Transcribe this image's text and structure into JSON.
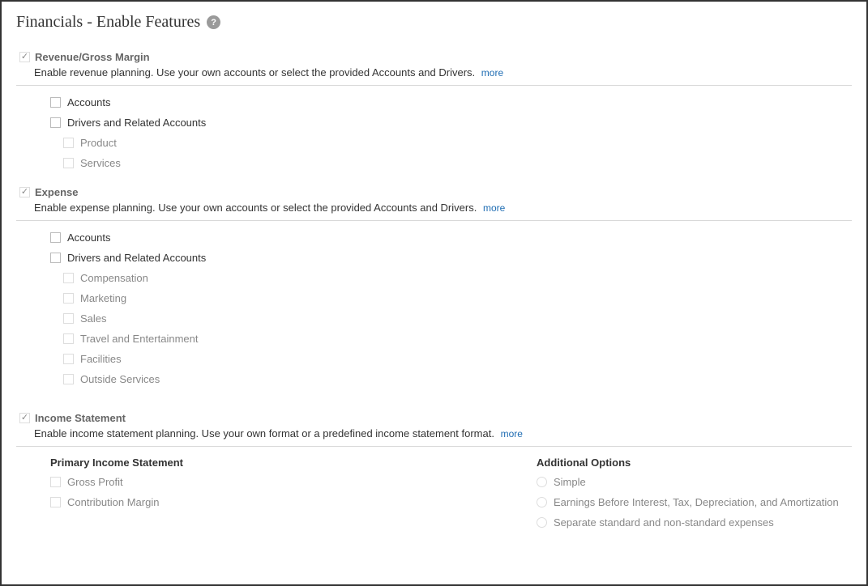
{
  "page": {
    "title": "Financials - Enable Features",
    "more_label": "more"
  },
  "sections": {
    "revenue": {
      "title": "Revenue/Gross Margin",
      "desc": "Enable revenue planning. Use your own accounts or select the provided Accounts and Drivers.",
      "accounts": "Accounts",
      "drivers": "Drivers and Related Accounts",
      "product": "Product",
      "services": "Services"
    },
    "expense": {
      "title": "Expense",
      "desc": "Enable expense planning. Use your own accounts or select the provided Accounts and Drivers.",
      "accounts": "Accounts",
      "drivers": "Drivers and Related Accounts",
      "compensation": "Compensation",
      "marketing": "Marketing",
      "sales": "Sales",
      "travel": "Travel and Entertainment",
      "facilities": "Facilities",
      "outside": "Outside Services"
    },
    "income": {
      "title": "Income Statement",
      "desc": "Enable income statement planning. Use your own format or a predefined income statement format.",
      "primary_header": "Primary Income Statement",
      "gross_profit": "Gross Profit",
      "contribution_margin": "Contribution Margin",
      "addl_header": "Additional Options",
      "simple": "Simple",
      "ebitda": "Earnings Before Interest, Tax, Depreciation, and Amortization",
      "separate": "Separate standard and non-standard expenses"
    }
  }
}
